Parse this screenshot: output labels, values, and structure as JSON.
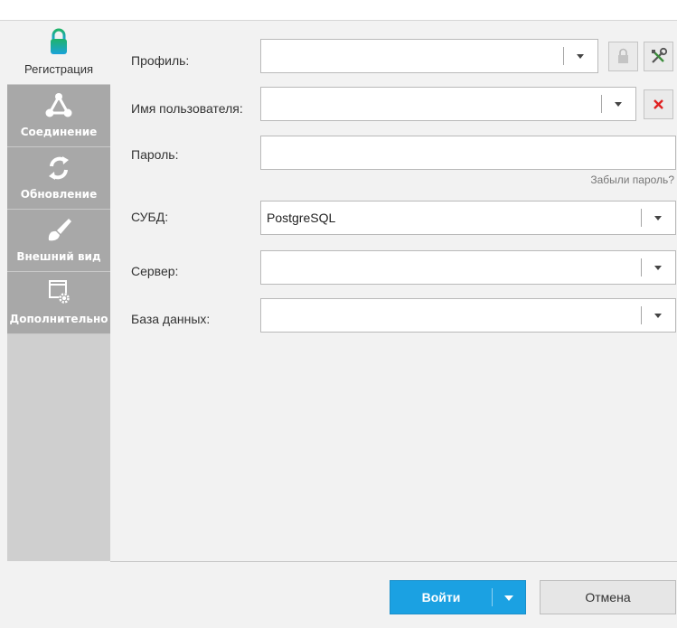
{
  "sidebar": {
    "items": [
      {
        "label": "Регистрация",
        "icon": "lock-icon",
        "active": true
      },
      {
        "label": "Соединение",
        "icon": "network-icon",
        "active": false
      },
      {
        "label": "Обновление",
        "icon": "refresh-icon",
        "active": false
      },
      {
        "label": "Внешний вид",
        "icon": "brush-icon",
        "active": false
      },
      {
        "label": "Дополнительно",
        "icon": "window-gear-icon",
        "active": false
      }
    ]
  },
  "form": {
    "profile": {
      "label": "Профиль:",
      "value": ""
    },
    "username": {
      "label": "Имя пользователя:",
      "value": ""
    },
    "password": {
      "label": "Пароль:",
      "value": "",
      "forgot": "Забыли пароль?"
    },
    "dbms": {
      "label": "СУБД:",
      "value": "PostgreSQL"
    },
    "server": {
      "label": "Сервер:",
      "value": ""
    },
    "database": {
      "label": "База данных:",
      "value": ""
    }
  },
  "footer": {
    "login_label": "Войти",
    "cancel_label": "Отмена"
  },
  "colors": {
    "accent": "#1ba1e2",
    "sidebar_tab": "#a8a8a8",
    "delete": "#e02020",
    "lock_gradient_top": "#1fb36b",
    "lock_gradient_bottom": "#1aa3d9"
  }
}
